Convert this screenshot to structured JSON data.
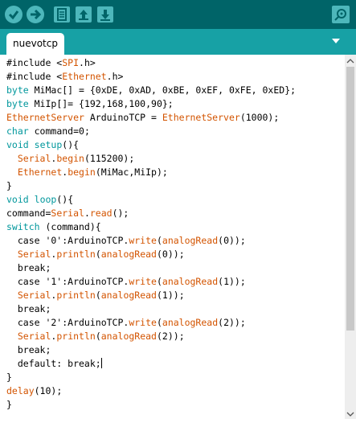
{
  "toolbar": {
    "buttons": [
      "verify-icon",
      "upload-icon",
      "new-icon",
      "open-icon",
      "save-icon"
    ],
    "right": "serial-monitor-icon"
  },
  "tab": {
    "label": "nuevotcp"
  },
  "code": {
    "lines": [
      [
        {
          "t": "#include <"
        },
        {
          "t": "SPI",
          "c": "fn"
        },
        {
          "t": ".h>"
        }
      ],
      [
        {
          "t": "#include <"
        },
        {
          "t": "Ethernet",
          "c": "fn"
        },
        {
          "t": ".h>"
        }
      ],
      [
        {
          "t": "byte",
          "c": "kw"
        },
        {
          "t": " MiMac[] = {0xDE, 0xAD, 0xBE, 0xEF, 0xFE, 0xED};"
        }
      ],
      [
        {
          "t": "byte",
          "c": "kw"
        },
        {
          "t": " MiIp[]= {192,168,100,90};"
        }
      ],
      [
        {
          "t": "EthernetServer",
          "c": "fn"
        },
        {
          "t": " ArduinoTCP = "
        },
        {
          "t": "EthernetServer",
          "c": "fn"
        },
        {
          "t": "(1000);"
        }
      ],
      [
        {
          "t": "char",
          "c": "kw"
        },
        {
          "t": " command=0;"
        }
      ],
      [
        {
          "t": "void",
          "c": "kw"
        },
        {
          "t": " "
        },
        {
          "t": "setup",
          "c": "kw"
        },
        {
          "t": "(){"
        }
      ],
      [
        {
          "t": "  "
        },
        {
          "t": "Serial",
          "c": "fn"
        },
        {
          "t": "."
        },
        {
          "t": "begin",
          "c": "fn"
        },
        {
          "t": "(115200);"
        }
      ],
      [
        {
          "t": "  "
        },
        {
          "t": "Ethernet",
          "c": "fn"
        },
        {
          "t": "."
        },
        {
          "t": "begin",
          "c": "fn"
        },
        {
          "t": "(MiMac,MiIp);"
        }
      ],
      [
        {
          "t": "}"
        }
      ],
      [
        {
          "t": "void",
          "c": "kw"
        },
        {
          "t": " "
        },
        {
          "t": "loop",
          "c": "kw"
        },
        {
          "t": "(){"
        }
      ],
      [
        {
          "t": "command="
        },
        {
          "t": "Serial",
          "c": "fn"
        },
        {
          "t": "."
        },
        {
          "t": "read",
          "c": "fn"
        },
        {
          "t": "();"
        }
      ],
      [
        {
          "t": "switch",
          "c": "kw"
        },
        {
          "t": " (command){"
        }
      ],
      [
        {
          "t": "  case '0':ArduinoTCP."
        },
        {
          "t": "write",
          "c": "fn"
        },
        {
          "t": "("
        },
        {
          "t": "analogRead",
          "c": "fn"
        },
        {
          "t": "(0));"
        }
      ],
      [
        {
          "t": "  "
        },
        {
          "t": "Serial",
          "c": "fn"
        },
        {
          "t": "."
        },
        {
          "t": "println",
          "c": "fn"
        },
        {
          "t": "("
        },
        {
          "t": "analogRead",
          "c": "fn"
        },
        {
          "t": "(0));"
        }
      ],
      [
        {
          "t": "  break;"
        }
      ],
      [
        {
          "t": "  case '1':ArduinoTCP."
        },
        {
          "t": "write",
          "c": "fn"
        },
        {
          "t": "("
        },
        {
          "t": "analogRead",
          "c": "fn"
        },
        {
          "t": "(1));"
        }
      ],
      [
        {
          "t": "  "
        },
        {
          "t": "Serial",
          "c": "fn"
        },
        {
          "t": "."
        },
        {
          "t": "println",
          "c": "fn"
        },
        {
          "t": "("
        },
        {
          "t": "analogRead",
          "c": "fn"
        },
        {
          "t": "(1));"
        }
      ],
      [
        {
          "t": "  break;"
        }
      ],
      [
        {
          "t": "  case '2':ArduinoTCP."
        },
        {
          "t": "write",
          "c": "fn"
        },
        {
          "t": "("
        },
        {
          "t": "analogRead",
          "c": "fn"
        },
        {
          "t": "(2));"
        }
      ],
      [
        {
          "t": "  "
        },
        {
          "t": "Serial",
          "c": "fn"
        },
        {
          "t": "."
        },
        {
          "t": "println",
          "c": "fn"
        },
        {
          "t": "("
        },
        {
          "t": "analogRead",
          "c": "fn"
        },
        {
          "t": "(2));"
        }
      ],
      [
        {
          "t": "  break;"
        }
      ],
      [
        {
          "t": "  default: break;"
        }
      ],
      [
        {
          "t": "}"
        }
      ],
      [
        {
          "t": "delay",
          "c": "fn"
        },
        {
          "t": "(10);"
        }
      ],
      [
        {
          "t": "}"
        }
      ]
    ],
    "cursor_line": 22
  },
  "colors": {
    "toolbar": "#006468",
    "tabbar": "#17a1a5",
    "keyword": "#00979c",
    "function": "#d35400"
  }
}
